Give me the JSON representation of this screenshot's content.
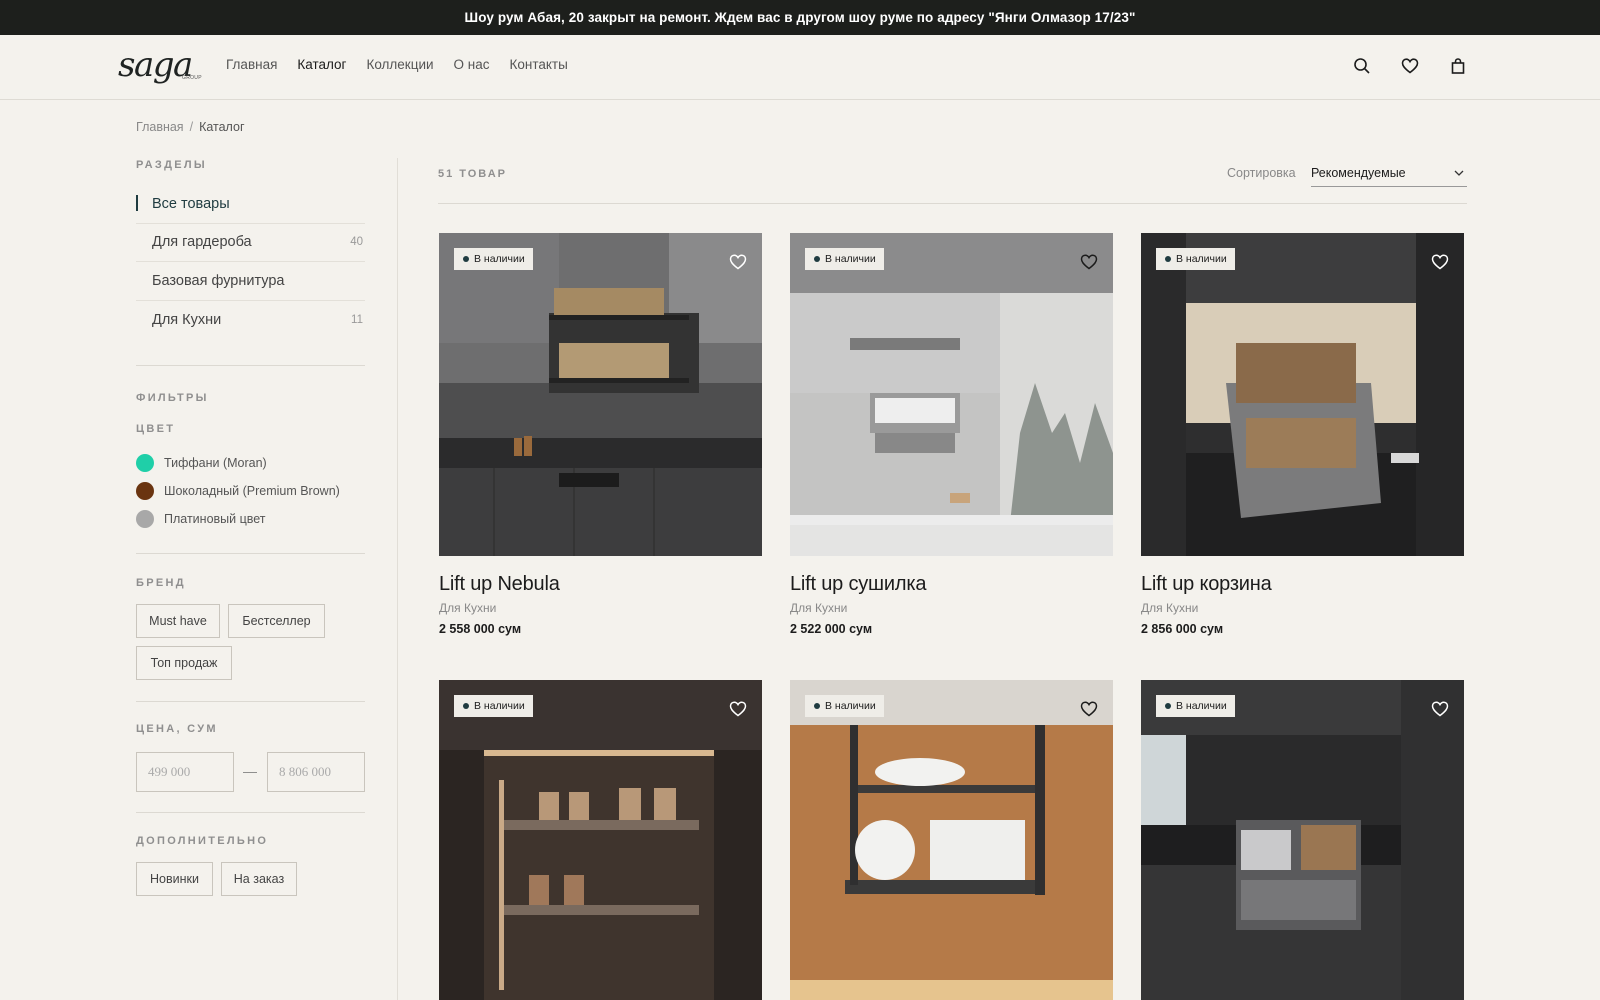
{
  "announcement": "Шоу рум Абая, 20 закрыт на ремонт. Ждем вас в другом шоу руме по адресу \"Янги Олмазор 17/23\"",
  "logo": {
    "word": "saga",
    "sub": "GROUP"
  },
  "nav": [
    "Главная",
    "Каталог",
    "Коллекции",
    "О нас",
    "Контакты"
  ],
  "header_icons": [
    "search-icon",
    "heart-icon",
    "bag-icon"
  ],
  "breadcrumbs": {
    "home": "Главная",
    "sep": "/",
    "current": "Каталог"
  },
  "sections": {
    "title": "РАЗДЕЛЫ",
    "items": [
      {
        "label": "Все товары",
        "count": ""
      },
      {
        "label": "Для гардероба",
        "count": "40"
      },
      {
        "label": "Базовая фурнитура",
        "count": ""
      },
      {
        "label": "Для Кухни",
        "count": "11"
      }
    ]
  },
  "filters": {
    "title": "ФИЛЬТРЫ",
    "color_title": "ЦВЕТ",
    "colors": [
      {
        "label": "Тиффани (Moran)",
        "hex": "#1fcfa8"
      },
      {
        "label": "Шоколадный (Premium Brown)",
        "hex": "#6a3410"
      },
      {
        "label": "Платиновый цвет",
        "hex": "#a8a8a8"
      }
    ],
    "brand_title": "БРЕНД",
    "brands": [
      "Must have",
      "Бестселлер",
      "Топ продаж"
    ],
    "price_title": "ЦЕНА, СУМ",
    "price_min": "499 000",
    "price_sep": "—",
    "price_max": "8 806 000",
    "extra_title": "ДОПОЛНИТЕЛЬНО",
    "extras": [
      "Новинки",
      "На заказ"
    ]
  },
  "catalog": {
    "count": "51 ТОВАР",
    "sort_label": "Сортировка",
    "sort_value": "Рекомендуемые"
  },
  "products": [
    {
      "badge": "В наличии",
      "name": "Lift up Nebula",
      "category": "Для Кухни",
      "price": "2 558 000 сум"
    },
    {
      "badge": "В наличии",
      "name": "Lift up сушилка",
      "category": "Для Кухни",
      "price": "2 522 000 сум"
    },
    {
      "badge": "В наличии",
      "name": "Lift up корзина",
      "category": "Для Кухни",
      "price": "2 856 000 сум"
    },
    {
      "badge": "В наличии"
    },
    {
      "badge": "В наличии"
    },
    {
      "badge": "В наличии"
    }
  ],
  "colors": {
    "accent": "#1f3b40",
    "background": "#f4f2ed",
    "topbar": "#1d1f1c"
  }
}
